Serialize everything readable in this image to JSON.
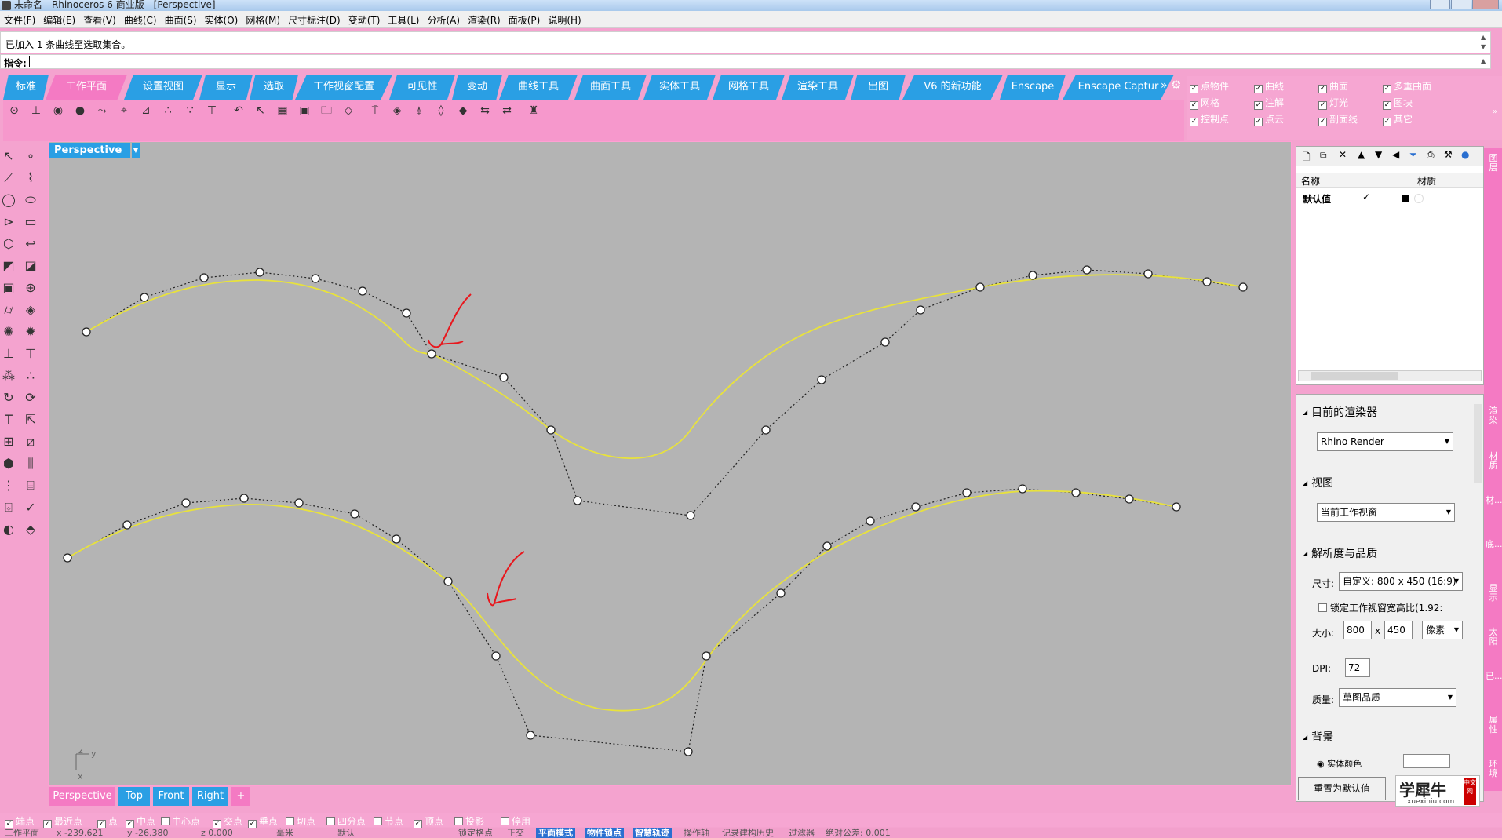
{
  "window": {
    "title": "未命名 - Rhinoceros 6 商业版 - [Perspective]"
  },
  "menu": [
    "文件(F)",
    "编辑(E)",
    "查看(V)",
    "曲线(C)",
    "曲面(S)",
    "实体(O)",
    "网格(M)",
    "尺寸标注(D)",
    "变动(T)",
    "工具(L)",
    "分析(A)",
    "渲染(R)",
    "面板(P)",
    "说明(H)"
  ],
  "command": {
    "history": "已加入 1 条曲线至选取集合。",
    "prompt": "指令:"
  },
  "tabs": [
    "标准",
    "工作平面",
    "设置视图",
    "显示",
    "选取",
    "工作视窗配置",
    "可见性",
    "变动",
    "曲线工具",
    "曲面工具",
    "实体工具",
    "网格工具",
    "渲染工具",
    "出图",
    "V6 的新功能",
    "Enscape",
    "Enscape Captur"
  ],
  "active_tab": "工作平面",
  "filters": [
    {
      "label": "点物件",
      "checked": true
    },
    {
      "label": "曲线",
      "checked": true
    },
    {
      "label": "曲面",
      "checked": true
    },
    {
      "label": "多重曲面",
      "checked": true
    },
    {
      "label": "网格",
      "checked": true
    },
    {
      "label": "注解",
      "checked": true
    },
    {
      "label": "灯光",
      "checked": true
    },
    {
      "label": "图块",
      "checked": true
    },
    {
      "label": "控制点",
      "checked": true
    },
    {
      "label": "点云",
      "checked": true
    },
    {
      "label": "剖面线",
      "checked": true
    },
    {
      "label": "其它",
      "checked": true
    }
  ],
  "viewport": {
    "name": "Perspective",
    "axes": {
      "z": "z",
      "y": "y",
      "x": "x"
    }
  },
  "viewport_tabs": [
    "Perspective",
    "Top",
    "Front",
    "Right"
  ],
  "layers": {
    "col_name": "名称",
    "col_material": "材质",
    "rows": [
      {
        "name": "默认值",
        "current": "✓"
      }
    ]
  },
  "render": {
    "current_renderer_label": "目前的渲染器",
    "renderer": "Rhino Render",
    "view_label": "视图",
    "view_value": "当前工作视窗",
    "resolution_label": "解析度与品质",
    "size_label": "尺寸:",
    "size_value": "自定义: 800 x 450 (16:9)",
    "lock_label": "锁定工作视窗宽高比(1.92:",
    "dims_label": "大小:",
    "width": "800",
    "height": "450",
    "unit": "像素",
    "dpi_label": "DPI:",
    "dpi": "72",
    "quality_label": "质量:",
    "quality": "草图品质",
    "background_label": "背景",
    "bg_option": "实体颜色",
    "reset_button": "重置为默认值"
  },
  "right_tabs": [
    "图层",
    "渲染",
    "材质",
    "材...",
    "底...",
    "显示",
    "太阳",
    "已...",
    "属性",
    "环境"
  ],
  "logo": {
    "main": "学犀牛",
    "url": "xuexiniu.com",
    "stamp": "中文网"
  },
  "osnaps": [
    {
      "label": "端点",
      "checked": true
    },
    {
      "label": "最近点",
      "checked": true
    },
    {
      "label": "点",
      "checked": true
    },
    {
      "label": "中点",
      "checked": true
    },
    {
      "label": "中心点",
      "checked": false
    },
    {
      "label": "交点",
      "checked": true
    },
    {
      "label": "垂点",
      "checked": true
    },
    {
      "label": "切点",
      "checked": false
    },
    {
      "label": "四分点",
      "checked": false
    },
    {
      "label": "节点",
      "checked": false
    },
    {
      "label": "顶点",
      "checked": true
    },
    {
      "label": "投影",
      "checked": false
    },
    {
      "label": "停用",
      "checked": false
    }
  ],
  "status": {
    "cplane": "工作平面",
    "x": "x -239.621",
    "y": "y -26.380",
    "z": "z 0.000",
    "unit": "毫米",
    "layer": "默认",
    "items": [
      {
        "label": "锁定格点",
        "hl": false
      },
      {
        "label": "正交",
        "hl": false
      },
      {
        "label": "平面模式",
        "hl": true
      },
      {
        "label": "物件锁点",
        "hl": true
      },
      {
        "label": "智慧轨迹",
        "hl": true
      },
      {
        "label": "操作轴",
        "hl": false
      },
      {
        "label": "记录建构历史",
        "hl": false
      },
      {
        "label": "过滤器",
        "hl": false
      },
      {
        "label": "绝对公差: 0.001",
        "hl": false
      }
    ]
  },
  "colors": {
    "accent_blue": "#2a9fe4",
    "accent_pink": "#f47ac3",
    "curve": "#e8e23c",
    "annotation": "#e8171d"
  }
}
